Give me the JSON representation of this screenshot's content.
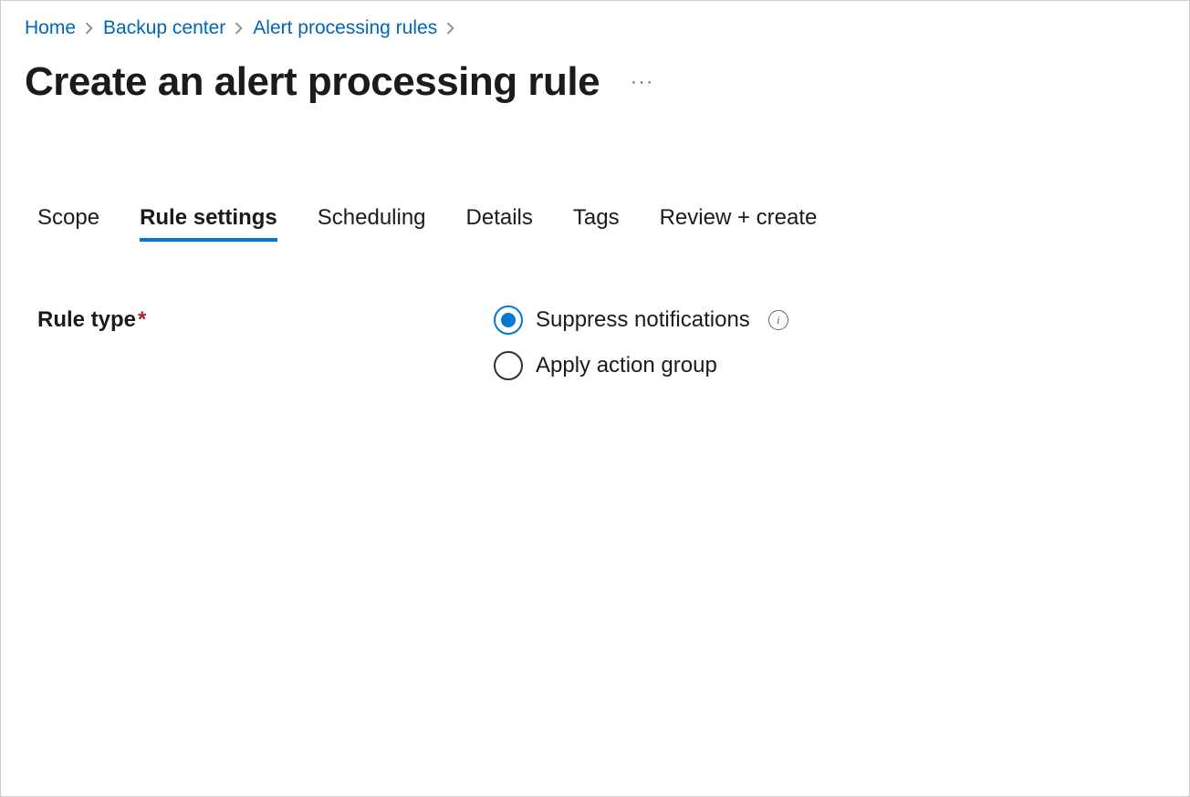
{
  "breadcrumb": {
    "items": [
      {
        "label": "Home"
      },
      {
        "label": "Backup center"
      },
      {
        "label": "Alert processing rules"
      }
    ]
  },
  "pageTitle": "Create an alert processing rule",
  "moreIcon": "···",
  "tabs": [
    {
      "label": "Scope",
      "active": false
    },
    {
      "label": "Rule settings",
      "active": true
    },
    {
      "label": "Scheduling",
      "active": false
    },
    {
      "label": "Details",
      "active": false
    },
    {
      "label": "Tags",
      "active": false
    },
    {
      "label": "Review + create",
      "active": false
    }
  ],
  "form": {
    "ruleTypeLabel": "Rule type",
    "requiredMark": "*",
    "options": {
      "suppress": "Suppress notifications",
      "apply": "Apply action group"
    },
    "infoGlyph": "i"
  }
}
